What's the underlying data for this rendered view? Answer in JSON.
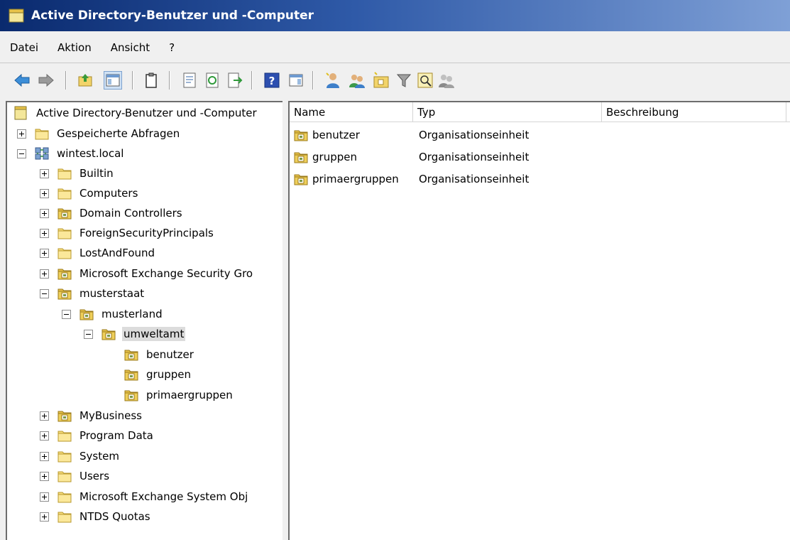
{
  "window": {
    "title": "Active Directory-Benutzer und -Computer"
  },
  "menu": [
    "Datei",
    "Aktion",
    "Ansicht",
    "?"
  ],
  "toolbar": {
    "buttons": [
      "back-arrow-icon",
      "forward-arrow-icon",
      "up-folder-icon",
      "show-hide-console-tree-icon",
      "clipboard-icon",
      "properties-icon",
      "refresh-icon",
      "export-list-icon",
      "help-icon",
      "action-pane-icon",
      "new-user-icon",
      "new-group-icon",
      "new-ou-icon",
      "filter-icon",
      "find-icon",
      "add-to-group-icon"
    ]
  },
  "tree": {
    "root": "Active Directory-Benutzer und -Computer",
    "items": [
      {
        "label": "Gespeicherte Abfragen",
        "icon": "folder-icon",
        "expander": "plus"
      },
      {
        "label": "wintest.local",
        "icon": "domain-icon",
        "expander": "minus"
      },
      {
        "label": "Builtin",
        "icon": "folder-icon",
        "expander": "plus"
      },
      {
        "label": "Computers",
        "icon": "folder-icon",
        "expander": "plus"
      },
      {
        "label": "Domain Controllers",
        "icon": "ou-icon",
        "expander": "plus"
      },
      {
        "label": "ForeignSecurityPrincipals",
        "icon": "folder-icon",
        "expander": "plus"
      },
      {
        "label": "LostAndFound",
        "icon": "folder-icon",
        "expander": "plus"
      },
      {
        "label": "Microsoft Exchange Security Gro",
        "icon": "ou-icon",
        "expander": "plus"
      },
      {
        "label": "musterstaat",
        "icon": "ou-icon",
        "expander": "minus"
      },
      {
        "label": "musterland",
        "icon": "ou-icon",
        "expander": "minus"
      },
      {
        "label": "umweltamt",
        "icon": "ou-icon",
        "expander": "minus"
      },
      {
        "label": "benutzer",
        "icon": "ou-icon",
        "expander": "none"
      },
      {
        "label": "gruppen",
        "icon": "ou-icon",
        "expander": "none"
      },
      {
        "label": "primaergruppen",
        "icon": "ou-icon",
        "expander": "none"
      },
      {
        "label": "MyBusiness",
        "icon": "ou-icon",
        "expander": "plus"
      },
      {
        "label": "Program Data",
        "icon": "folder-icon",
        "expander": "plus"
      },
      {
        "label": "System",
        "icon": "folder-icon",
        "expander": "plus"
      },
      {
        "label": "Users",
        "icon": "folder-icon",
        "expander": "plus"
      },
      {
        "label": "Microsoft Exchange System Obj",
        "icon": "folder-icon",
        "expander": "plus"
      },
      {
        "label": "NTDS Quotas",
        "icon": "folder-icon",
        "expander": "plus"
      }
    ]
  },
  "list": {
    "columns": [
      "Name",
      "Typ",
      "Beschreibung"
    ],
    "rows": [
      {
        "name": "benutzer",
        "type": "Organisationseinheit",
        "description": ""
      },
      {
        "name": "gruppen",
        "type": "Organisationseinheit",
        "description": ""
      },
      {
        "name": "primaergruppen",
        "type": "Organisationseinheit",
        "description": ""
      }
    ]
  }
}
